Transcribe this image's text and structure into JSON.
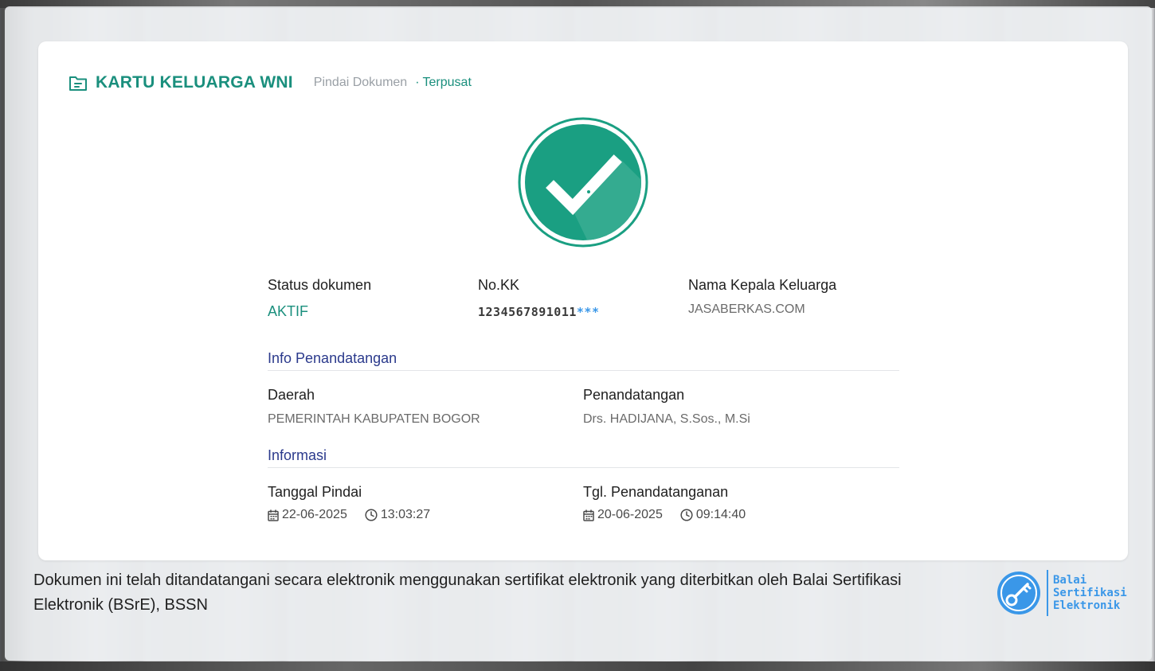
{
  "document": {
    "title": "KARTU KELUARGA WNI",
    "breadcrumb_scan": "Pindai Dokumen",
    "breadcrumb_separator": "·",
    "breadcrumb_active": "Terpusat"
  },
  "summary": {
    "status_label": "Status dokumen",
    "status_value": "AKTIF",
    "kk_label": "No.KK",
    "kk_value": "1234567891011",
    "kk_mask": "***",
    "head_label": "Nama Kepala Keluarga",
    "head_value": "JASABERKAS.COM"
  },
  "signing_info": {
    "section_title": "Info Penandatangan",
    "region_label": "Daerah",
    "region_value": "PEMERINTAH KABUPATEN BOGOR",
    "signer_label": "Penandatangan",
    "signer_value": "Drs. HADIJANA, S.Sos., M.Si"
  },
  "information": {
    "section_title": "Informasi",
    "scan_label": "Tanggal Pindai",
    "scan_date": "22-06-2025",
    "scan_time": "13:03:27",
    "sign_label": "Tgl. Penandatanganan",
    "sign_date": "20-06-2025",
    "sign_time": "09:14:40"
  },
  "footer": {
    "notice": "Dokumen ini telah ditandatangani secara elektronik menggunakan sertifikat elektronik yang diterbitkan oleh Balai Sertifikasi Elektronik (BSrE), BSSN",
    "logo_line1": "Balai",
    "logo_line2": "Sertifikasi",
    "logo_line3": "Elektronik"
  },
  "colors": {
    "accent_green": "#1a8f7d",
    "section_blue": "#2b3a8c",
    "mask_blue": "#3a97e8"
  },
  "icons": {
    "header": "folder-document-icon",
    "status": "check-badge-icon",
    "date": "calendar-icon",
    "time": "clock-icon",
    "logo": "key-icon"
  }
}
